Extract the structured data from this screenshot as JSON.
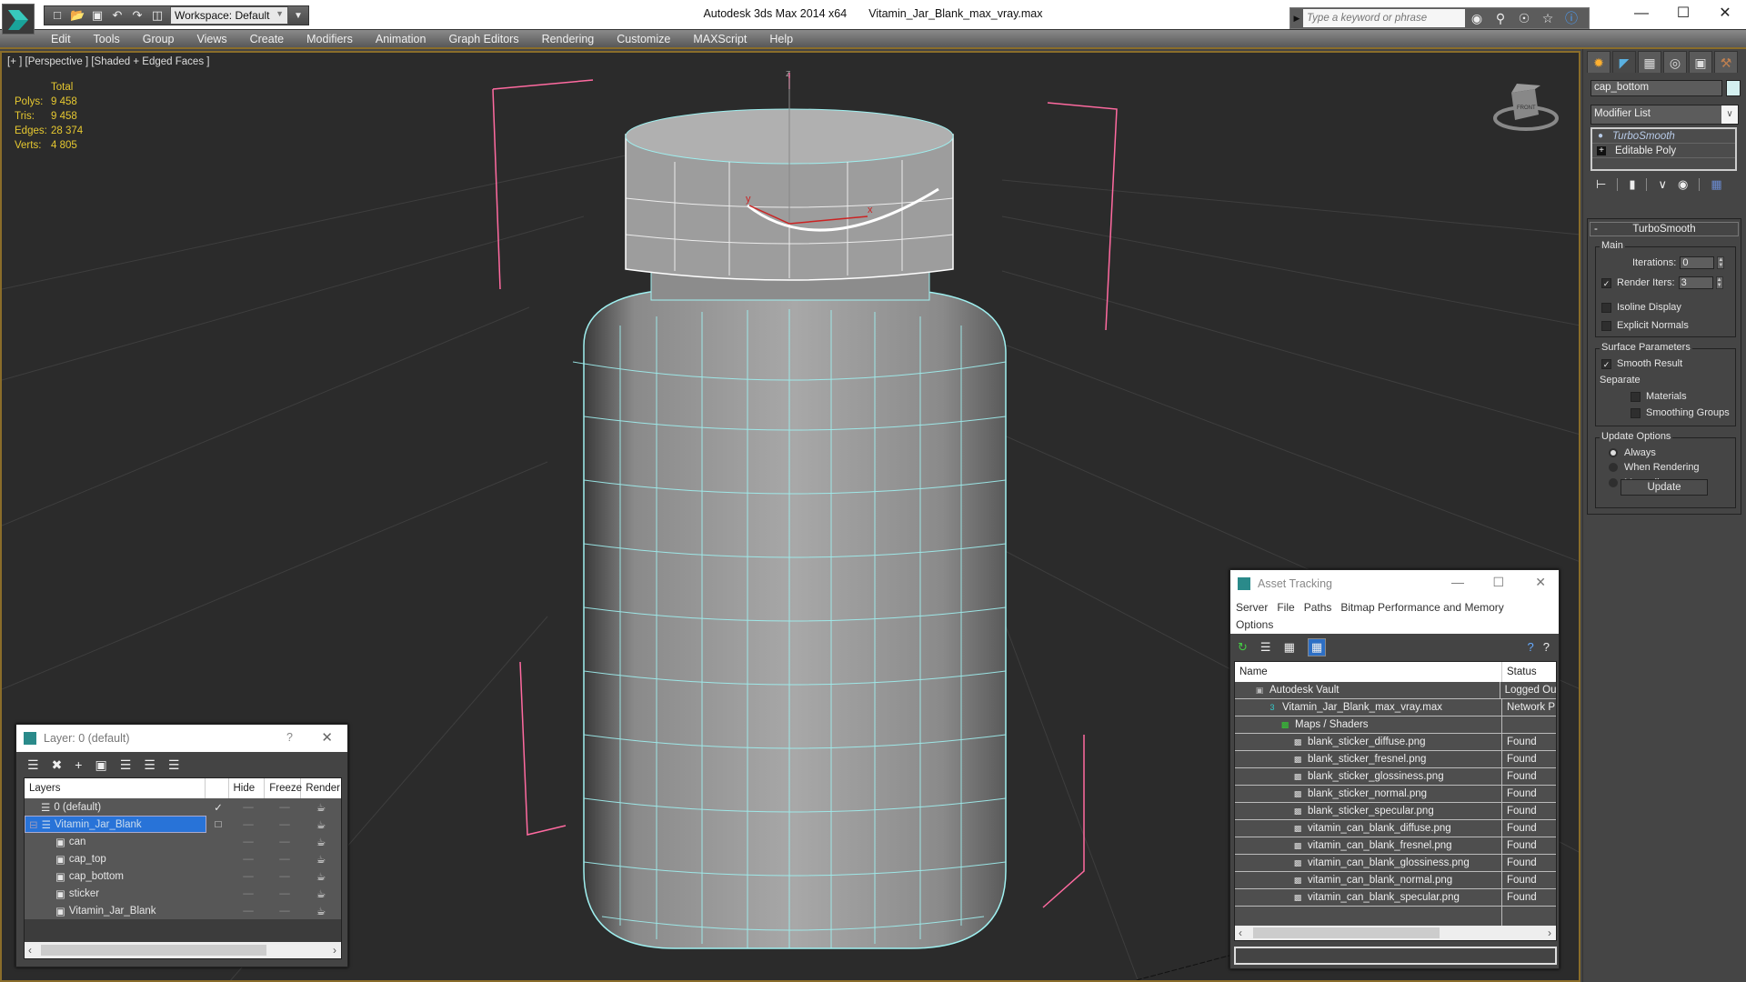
{
  "app": {
    "title": "Autodesk 3ds Max  2014 x64",
    "filename": "Vitamin_Jar_Blank_max_vray.max",
    "workspace_label": "Workspace: Default",
    "search_placeholder": "Type a keyword or phrase"
  },
  "quick_access_icons": [
    "new-file-icon",
    "open-file-icon",
    "save-icon",
    "undo-icon",
    "redo-icon",
    "project-folder-icon"
  ],
  "search_icons": [
    "binoculars-icon",
    "key-icon",
    "satellite-icon",
    "star-icon",
    "help-icon"
  ],
  "menu": [
    "Edit",
    "Tools",
    "Group",
    "Views",
    "Create",
    "Modifiers",
    "Animation",
    "Graph Editors",
    "Rendering",
    "Customize",
    "MAXScript",
    "Help"
  ],
  "viewport": {
    "label": "[+ ] [Perspective ] [Shaded + Edged Faces ]",
    "stats": {
      "header": "Total",
      "rows": [
        {
          "label": "Polys:",
          "value": "9 458"
        },
        {
          "label": "Tris:",
          "value": "9 458"
        },
        {
          "label": "Edges:",
          "value": "28 374"
        },
        {
          "label": "Verts:",
          "value": "4 805"
        }
      ]
    },
    "viewcube_label": "FRONT",
    "gizmo_axes": {
      "x": "x",
      "y": "y",
      "z": "z"
    },
    "colors": {
      "wire": "#9ff0f0",
      "selection": "#ff6aa0",
      "bg": "#2b2b2b",
      "stats": "#e6c830"
    }
  },
  "command_panel": {
    "tabs": [
      "create",
      "modify",
      "hierarchy",
      "motion",
      "display",
      "utilities"
    ],
    "object_name": "cap_bottom",
    "object_color": "#d4f0f0",
    "modifier_list": "Modifier List",
    "stack": [
      {
        "label": "TurboSmooth",
        "selected": true
      },
      {
        "label": "Editable Poly",
        "selected": false
      }
    ],
    "rollout": {
      "title": "TurboSmooth",
      "main_label": "Main",
      "iterations_label": "Iterations:",
      "iterations_value": "0",
      "render_iters_label": "Render Iters:",
      "render_iters_value": "3",
      "render_iters_checked": true,
      "isoline_label": "Isoline Display",
      "isoline_checked": false,
      "explicit_normals_label": "Explicit Normals",
      "explicit_normals_checked": false,
      "surface_label": "Surface Parameters",
      "smooth_result_label": "Smooth Result",
      "smooth_result_checked": true,
      "separate_label": "Separate",
      "materials_label": "Materials",
      "smoothing_groups_label": "Smoothing Groups",
      "update_options_label": "Update Options",
      "update_options": [
        {
          "label": "Always",
          "selected": true
        },
        {
          "label": "When Rendering",
          "selected": false
        },
        {
          "label": "Manually",
          "selected": false
        }
      ],
      "update_button": "Update"
    }
  },
  "layer_dialog": {
    "title": "Layer: 0 (default)",
    "help": "?",
    "columns": [
      "Layers",
      "",
      "Hide",
      "Freeze",
      "Render"
    ],
    "rows": [
      {
        "name": "0 (default)",
        "type": "layer",
        "indent": 1,
        "current": true,
        "selected": false
      },
      {
        "name": "Vitamin_Jar_Blank",
        "type": "layer",
        "indent": 0,
        "current": false,
        "selected": true,
        "expanded": true
      },
      {
        "name": "can",
        "type": "object",
        "indent": 2
      },
      {
        "name": "cap_top",
        "type": "object",
        "indent": 2
      },
      {
        "name": "cap_bottom",
        "type": "object",
        "indent": 2
      },
      {
        "name": "sticker",
        "type": "object",
        "indent": 2
      },
      {
        "name": "Vitamin_Jar_Blank",
        "type": "object",
        "indent": 2
      }
    ]
  },
  "asset_dialog": {
    "title": "Asset Tracking",
    "menu": [
      "Server",
      "File",
      "Paths",
      "Bitmap Performance and Memory",
      "Options"
    ],
    "columns": {
      "name": "Name",
      "status": "Status"
    },
    "rows": [
      {
        "name": "Autodesk Vault",
        "status": "Logged Ou",
        "indent": 1,
        "icon": "vault-icon"
      },
      {
        "name": "Vitamin_Jar_Blank_max_vray.max",
        "status": "Network P",
        "indent": 2,
        "icon": "max-file-icon"
      },
      {
        "name": "Maps / Shaders",
        "status": "",
        "indent": 3,
        "icon": "maps-icon"
      },
      {
        "name": "blank_sticker_diffuse.png",
        "status": "Found",
        "indent": 4,
        "icon": "png-icon"
      },
      {
        "name": "blank_sticker_fresnel.png",
        "status": "Found",
        "indent": 4,
        "icon": "png-icon"
      },
      {
        "name": "blank_sticker_glossiness.png",
        "status": "Found",
        "indent": 4,
        "icon": "png-icon"
      },
      {
        "name": "blank_sticker_normal.png",
        "status": "Found",
        "indent": 4,
        "icon": "png-icon"
      },
      {
        "name": "blank_sticker_specular.png",
        "status": "Found",
        "indent": 4,
        "icon": "png-icon"
      },
      {
        "name": "vitamin_can_blank_diffuse.png",
        "status": "Found",
        "indent": 4,
        "icon": "png-icon"
      },
      {
        "name": "vitamin_can_blank_fresnel.png",
        "status": "Found",
        "indent": 4,
        "icon": "png-icon"
      },
      {
        "name": "vitamin_can_blank_glossiness.png",
        "status": "Found",
        "indent": 4,
        "icon": "png-icon"
      },
      {
        "name": "vitamin_can_blank_normal.png",
        "status": "Found",
        "indent": 4,
        "icon": "png-icon"
      },
      {
        "name": "vitamin_can_blank_specular.png",
        "status": "Found",
        "indent": 4,
        "icon": "png-icon"
      }
    ]
  }
}
